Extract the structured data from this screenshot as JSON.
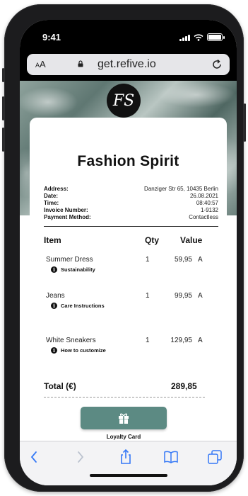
{
  "status_bar": {
    "time": "9:41"
  },
  "browser": {
    "text_size_label": "AA",
    "url": "get.refive.io"
  },
  "receipt": {
    "logo_text": "FS",
    "store_name": "Fashion Spirit",
    "meta": [
      {
        "key": "Address:",
        "value": "Danziger Str 65, 10435 Berlin"
      },
      {
        "key": "Date:",
        "value": "26.08.2021"
      },
      {
        "key": "Time:",
        "value": "08:40:57"
      },
      {
        "key": "Invoice Number:",
        "value": "1-9132"
      },
      {
        "key": "Payment Method:",
        "value": "Contactless"
      }
    ],
    "columns": {
      "item": "Item",
      "qty": "Qty",
      "value": "Value"
    },
    "items": [
      {
        "name": "Summer Dress",
        "qty": "1",
        "value": "59,95",
        "tax": "A",
        "info": "Sustainability"
      },
      {
        "name": "Jeans",
        "qty": "1",
        "value": "99,95",
        "tax": "A",
        "info": "Care Instructions"
      },
      {
        "name": "White Sneakers",
        "qty": "1",
        "value": "129,95",
        "tax": "A",
        "info": "How to customize"
      }
    ],
    "total_label": "Total (€)",
    "total_amount": "289,85",
    "loyalty_label": "Loyalty Card"
  },
  "colors": {
    "accent": "#5c8a83",
    "text": "#111111"
  },
  "toolbar": {
    "icons": [
      "back-icon",
      "forward-icon",
      "share-icon",
      "bookmarks-icon",
      "tabs-icon"
    ]
  }
}
